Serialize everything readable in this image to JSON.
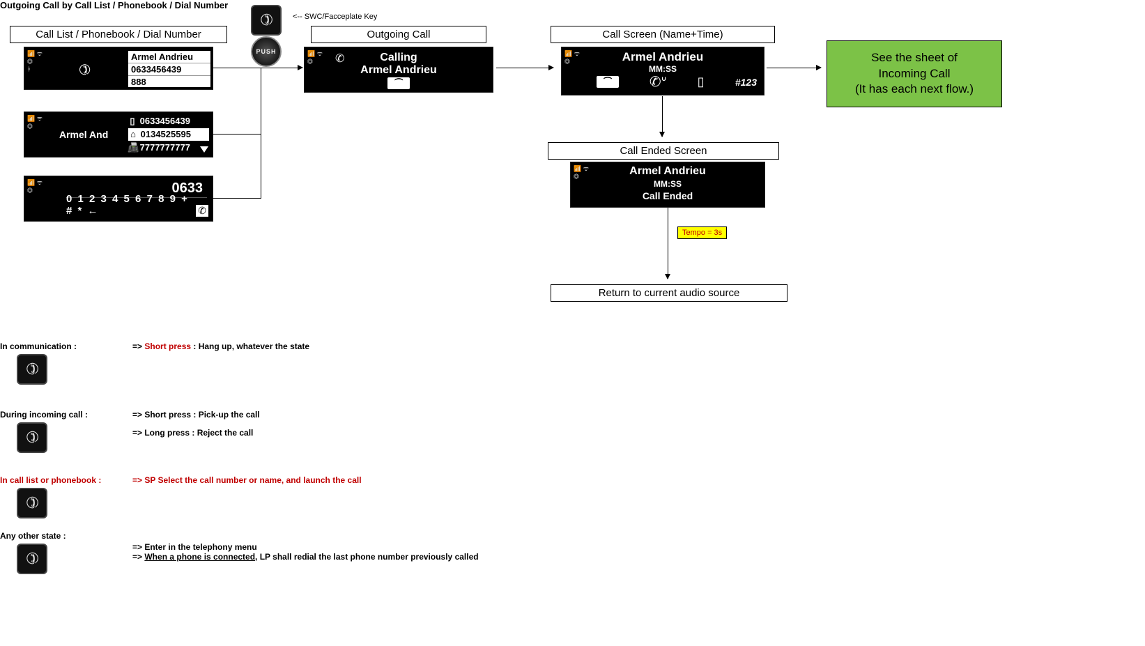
{
  "page_title": "Outgoing Call by Call List / Phonebook / Dial Number",
  "swc_note": "<-- SWC/Facceplate Key",
  "labels": {
    "selectors": "Call List / Phonebook / Dial Number",
    "outgoing": "Outgoing Call",
    "callscreen": "Call Screen (Name+Time)",
    "ended": "Call Ended Screen",
    "return": "Return to current audio source"
  },
  "green": {
    "line1": "See the sheet of",
    "line2": "Incoming Call",
    "line3": "(It has each next flow.)"
  },
  "tempo": "Tempo = 3s",
  "call_list_screen": {
    "entries": [
      "Armel Andrieu",
      "0633456439",
      "888"
    ]
  },
  "phonebook_screen": {
    "name": "Armel And",
    "entries": [
      {
        "icon": "mobile",
        "num": "0633456439"
      },
      {
        "icon": "home",
        "num": "0134525595",
        "selected": true
      },
      {
        "icon": "fax",
        "num": "7777777777"
      }
    ]
  },
  "dial_screen": {
    "typed": "0633",
    "keys": "0 1 2 3 4 5 6 7 8 9 + # * ←"
  },
  "outgoing_screen": {
    "line1": "Calling",
    "line2": "Armel Andrieu"
  },
  "active_call_screen": {
    "name": "Armel Andrieu",
    "time": "MM:SS",
    "code": "#123"
  },
  "ended_screen": {
    "name": "Armel Andrieu",
    "time": "MM:SS",
    "status": "Call Ended"
  },
  "push_label": "PUSH",
  "legend": {
    "s1_label": "In communication :",
    "s1_a_prefix": "=> ",
    "s1_a_red": "Short press",
    "s1_a_rest": " : Hang up, whatever the state",
    "s2_label": "During incoming call  :",
    "s2_a": "=> Short press : Pick-up the call",
    "s2_b": "=> Long press : Reject the call",
    "s3_label": "In call list or phonebook :",
    "s3_a": "=> SP Select the call number or name, and launch the call",
    "s4_label": "Any other state :",
    "s4_a": "=> Enter in the telephony menu",
    "s4_b_prefix": "=> ",
    "s4_b_uline": "When a phone is connected",
    "s4_b_rest": ", LP shall redial the last phone number previously called"
  }
}
